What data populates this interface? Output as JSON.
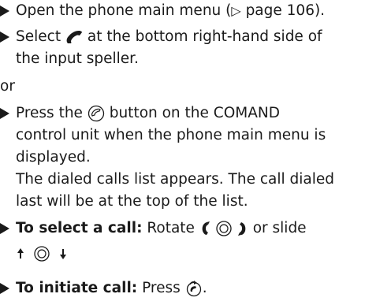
{
  "steps": [
    {
      "pre": "Open the phone main menu (",
      "ref_glyph": "▷",
      "post": " page 106)."
    },
    {
      "pre": "Select",
      "post": "at the bottom right-hand side of",
      "line2": "the input speller."
    },
    {
      "or": "or"
    },
    {
      "line1_pre": "Press the",
      "line1_post": "button on the COMAND",
      "line2": "control unit when the phone main menu is",
      "line3": "displayed.",
      "line4": "The dialed calls list appears. The call dialed",
      "line5": "last will be at the top of the list."
    },
    {
      "bold": "To select a call:",
      "pre": "Rotate",
      "mid": "or slide"
    },
    {
      "bold": "To initiate call:",
      "pre": "Press",
      "post": "."
    }
  ],
  "icons": {
    "arrow": "triangle-bullet-icon",
    "phone": "phone-handset-icon",
    "send": "phone-button-icon",
    "rotate": "rotate-controller-icon",
    "slide": "slide-controller-icon",
    "press": "press-controller-icon"
  }
}
